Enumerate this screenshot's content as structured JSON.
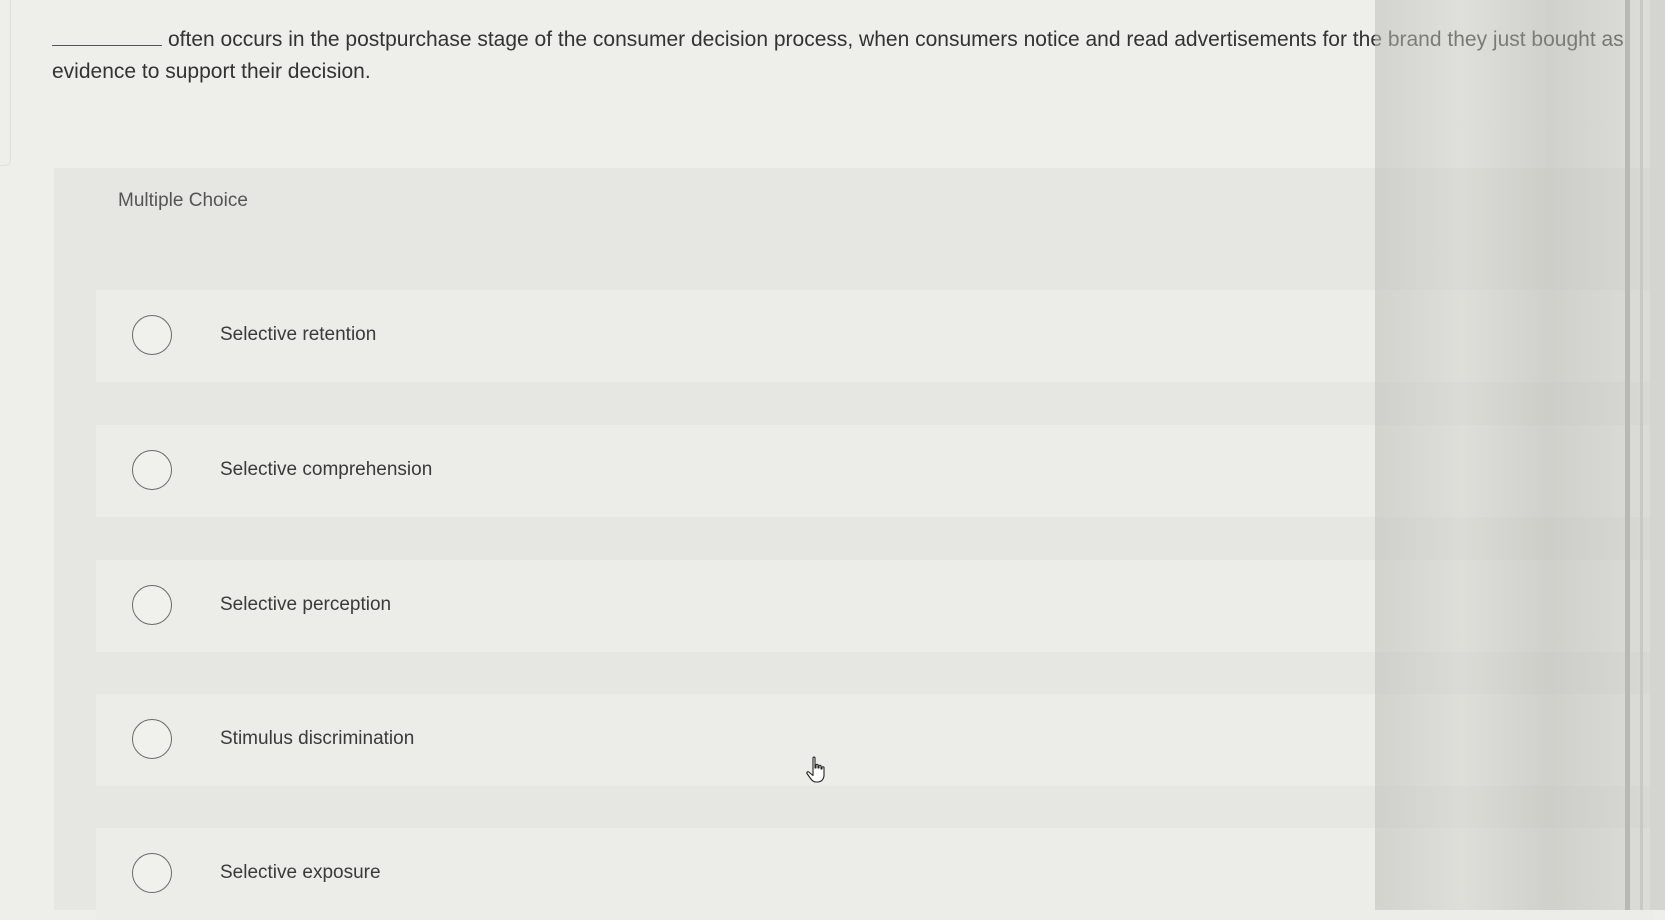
{
  "question": {
    "text": "often occurs in the postpurchase stage of the consumer decision process, when consumers notice and read advertisements for the brand they just bought as evidence to support their decision."
  },
  "multiple_choice": {
    "label": "Multiple Choice",
    "options": [
      {
        "label": "Selective retention"
      },
      {
        "label": "Selective comprehension"
      },
      {
        "label": "Selective perception"
      },
      {
        "label": "Stimulus discrimination"
      },
      {
        "label": "Selective exposure"
      }
    ]
  },
  "cursor": {
    "icon": "hand-pointer-icon"
  }
}
